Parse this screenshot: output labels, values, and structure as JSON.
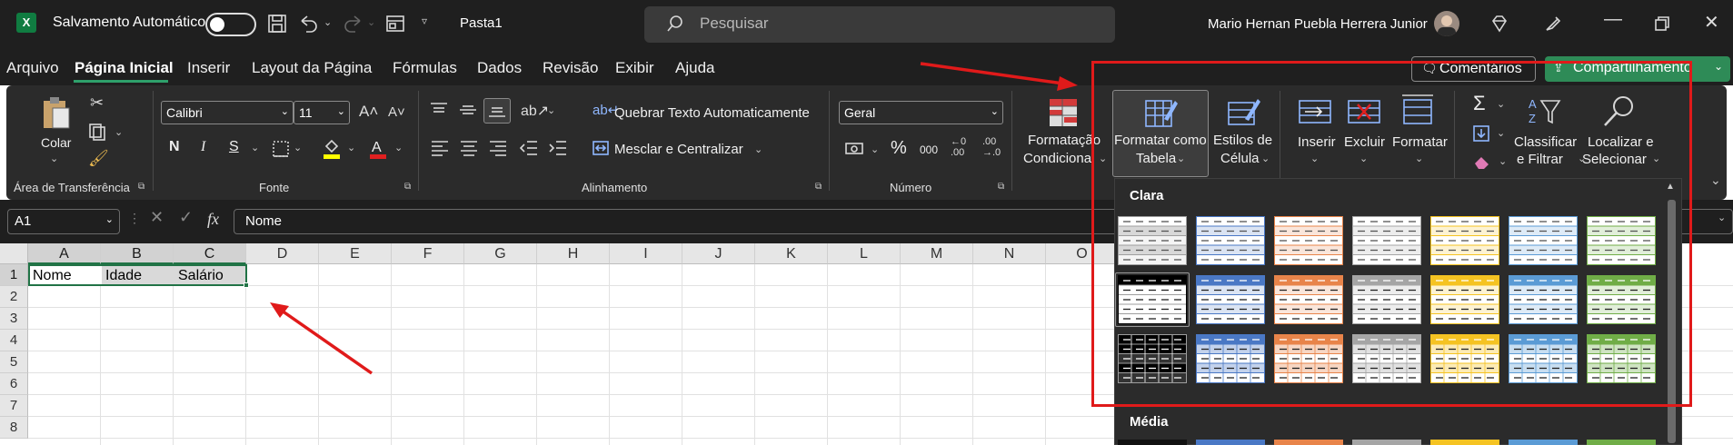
{
  "titlebar": {
    "app_icon": "excel-logo",
    "autosave_label": "Salvamento Automático",
    "autosave_state": "off",
    "file_name": "Pasta1",
    "search_placeholder": "Pesquisar",
    "user_name": "Mario Hernan Puebla Herrera Junior"
  },
  "tabs": [
    {
      "label": "Arquivo",
      "active": false
    },
    {
      "label": "Página Inicial",
      "active": true
    },
    {
      "label": "Inserir",
      "active": false
    },
    {
      "label": "Layout da Página",
      "active": false
    },
    {
      "label": "Fórmulas",
      "active": false
    },
    {
      "label": "Dados",
      "active": false
    },
    {
      "label": "Revisão",
      "active": false
    },
    {
      "label": "Exibir",
      "active": false
    },
    {
      "label": "Ajuda",
      "active": false
    }
  ],
  "actions": {
    "comments_label": "Comentários",
    "share_label": "Compartilhamento"
  },
  "ribbon": {
    "clipboard": {
      "paste_label": "Colar",
      "group_title": "Área de Transferência"
    },
    "font": {
      "font_name": "Calibri",
      "font_size": "11",
      "group_title": "Fonte",
      "bold": "N",
      "italic": "I",
      "underline": "S"
    },
    "alignment": {
      "wrap_label": "Quebrar Texto Automaticamente",
      "merge_label": "Mesclar e Centralizar",
      "group_title": "Alinhamento"
    },
    "number": {
      "format": "Geral",
      "group_title": "Número",
      "thousands": "000"
    },
    "styles": {
      "cond_format_l1": "Formatação",
      "cond_format_l2": "Condicional",
      "format_table_l1": "Formatar como",
      "format_table_l2": "Tabela",
      "cell_styles_l1": "Estilos de",
      "cell_styles_l2": "Célula"
    },
    "cells": {
      "insert": "Inserir",
      "delete": "Excluir",
      "format": "Formatar"
    },
    "editing": {
      "sort_l1": "Classificar",
      "sort_l2": "e Filtrar",
      "find_l1": "Localizar e",
      "find_l2": "Selecionar"
    }
  },
  "formula_bar": {
    "name_box": "A1",
    "fx": "fx",
    "content": "Nome"
  },
  "sheet": {
    "columns": [
      "A",
      "B",
      "C",
      "D",
      "E",
      "F",
      "G",
      "H",
      "I",
      "J",
      "K",
      "L",
      "M",
      "N",
      "O"
    ],
    "rows": [
      "1",
      "2",
      "3",
      "4",
      "5",
      "6",
      "7",
      "8"
    ],
    "cells": {
      "A1": "Nome",
      "B1": "Idade",
      "C1": "Salário"
    }
  },
  "gallery": {
    "section_light": "Clara",
    "section_medium": "Média",
    "colors": [
      "#9e9e9e",
      "#4a78c5",
      "#e8844a",
      "#a5a5a5",
      "#f5c322",
      "#5b9bd5",
      "#70ad47"
    ]
  },
  "annotation_color": "#e01a1a"
}
